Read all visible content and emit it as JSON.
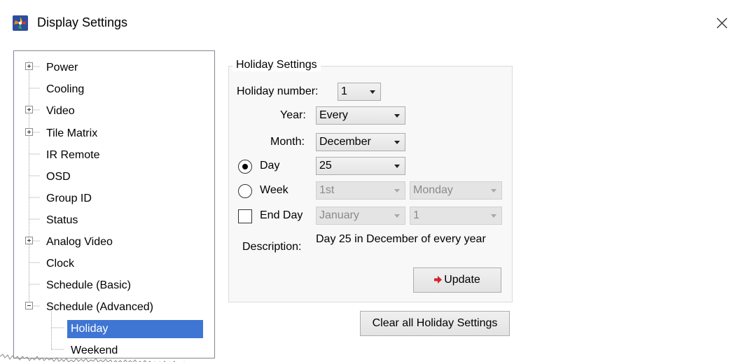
{
  "window": {
    "title": "Display Settings",
    "icon": "display-settings-app-icon",
    "close_icon": "close-icon"
  },
  "tree": {
    "items": [
      {
        "label": "Power",
        "expander": "plus"
      },
      {
        "label": "Cooling"
      },
      {
        "label": "Video",
        "expander": "plus"
      },
      {
        "label": "Tile Matrix",
        "expander": "plus"
      },
      {
        "label": "IR Remote"
      },
      {
        "label": "OSD"
      },
      {
        "label": "Group ID"
      },
      {
        "label": "Status"
      },
      {
        "label": "Analog Video",
        "expander": "plus"
      },
      {
        "label": "Clock"
      },
      {
        "label": "Schedule (Basic)"
      },
      {
        "label": "Schedule (Advanced)",
        "expander": "minus"
      },
      {
        "label": "Holiday",
        "selected": true,
        "child": true
      },
      {
        "label": "Weekend",
        "child": true
      }
    ]
  },
  "holiday": {
    "group_title": "Holiday Settings",
    "holiday_number_label": "Holiday number:",
    "holiday_number_value": "1",
    "year_label": "Year:",
    "year_value": "Every",
    "month_label": "Month:",
    "month_value": "December",
    "day_radio_label": "Day",
    "day_value": "25",
    "day_selected": true,
    "week_radio_label": "Week",
    "week_ordinal_value": "1st",
    "week_weekday_value": "Monday",
    "end_day_label": "End Day",
    "end_day_checked": false,
    "end_month_value": "January",
    "end_day_value": "1",
    "description_label": "Description:",
    "description_text": "Day 25 in December of every year",
    "update_label": "Update",
    "update_icon": "red-arrow-right-icon",
    "clear_label": "Clear all Holiday Settings"
  },
  "colors": {
    "selection": "#3f76d4",
    "update_icon": "#d4212b"
  }
}
